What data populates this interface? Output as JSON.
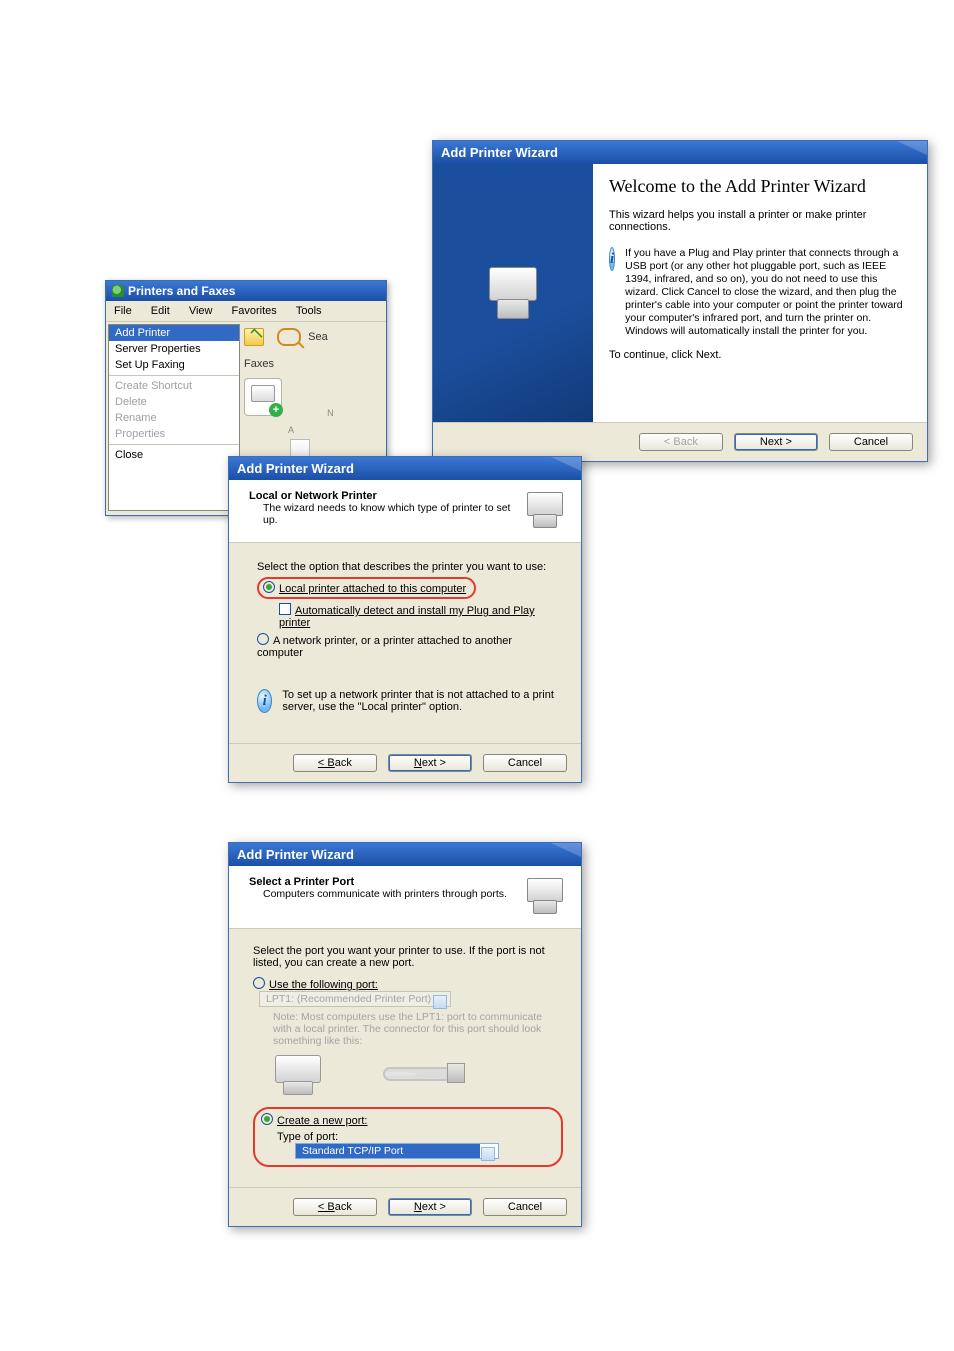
{
  "printersFaxes": {
    "title": "Printers and Faxes",
    "menubar": [
      "File",
      "Edit",
      "View",
      "Favorites",
      "Tools"
    ],
    "fileMenu": {
      "addPrinter": "Add Printer",
      "serverProps": "Server Properties",
      "setupFaxing": "Set Up Faxing",
      "createShortcut": "Create Shortcut",
      "delete": "Delete",
      "rename": "Rename",
      "properties": "Properties",
      "close": "Close"
    },
    "rightArea": {
      "searchHint": "Sea",
      "faxesLabel": "Faxes",
      "n": "N",
      "a": "A"
    }
  },
  "wiz1": {
    "title": "Add Printer Wizard",
    "heading": "Welcome to the Add Printer Wizard",
    "intro": "This wizard helps you install a printer or make printer connections.",
    "info": "If you have a Plug and Play printer that connects through a USB port (or any other hot pluggable port, such as IEEE 1394, infrared, and so on), you do not need to use this wizard. Click Cancel to close the wizard, and then plug the printer's cable into your computer or point the printer toward your computer's infrared port, and turn the printer on. Windows will automatically install the printer for you.",
    "cont": "To continue, click Next.",
    "btnBack": "< Back",
    "btnNext": "Next >",
    "btnCancel": "Cancel"
  },
  "wiz2": {
    "title": "Add Printer Wizard",
    "hdr": "Local or Network Printer",
    "hdrSub": "The wizard needs to know which type of printer to set up.",
    "prompt": "Select the option that describes the printer you want to use:",
    "optLocal": "Local printer attached to this computer",
    "optAuto": "Automatically detect and install my Plug and Play printer",
    "optNet": "A network printer, or a printer attached to another computer",
    "note": "To set up a network printer that is not attached to a print server, use the \"Local printer\" option.",
    "btnBack": "< Back",
    "btnNext": "Next >",
    "btnCancel": "Cancel"
  },
  "wiz3": {
    "title": "Add Printer Wizard",
    "hdr": "Select a Printer Port",
    "hdrSub": "Computers communicate with printers through ports.",
    "prompt": "Select the port you want your printer to use. If the port is not listed, you can create a new port.",
    "optUse": "Use the following port:",
    "useVal": "LPT1: (Recommended Printer Port)",
    "note": "Note: Most computers use the LPT1: port to communicate with a local printer. The connector for this port should look something like this:",
    "optCreate": "Create a new port:",
    "typeLabel": "Type of port:",
    "typeVal": "Standard TCP/IP Port",
    "btnBack": "< Back",
    "btnNext": "Next >",
    "btnCancel": "Cancel"
  }
}
